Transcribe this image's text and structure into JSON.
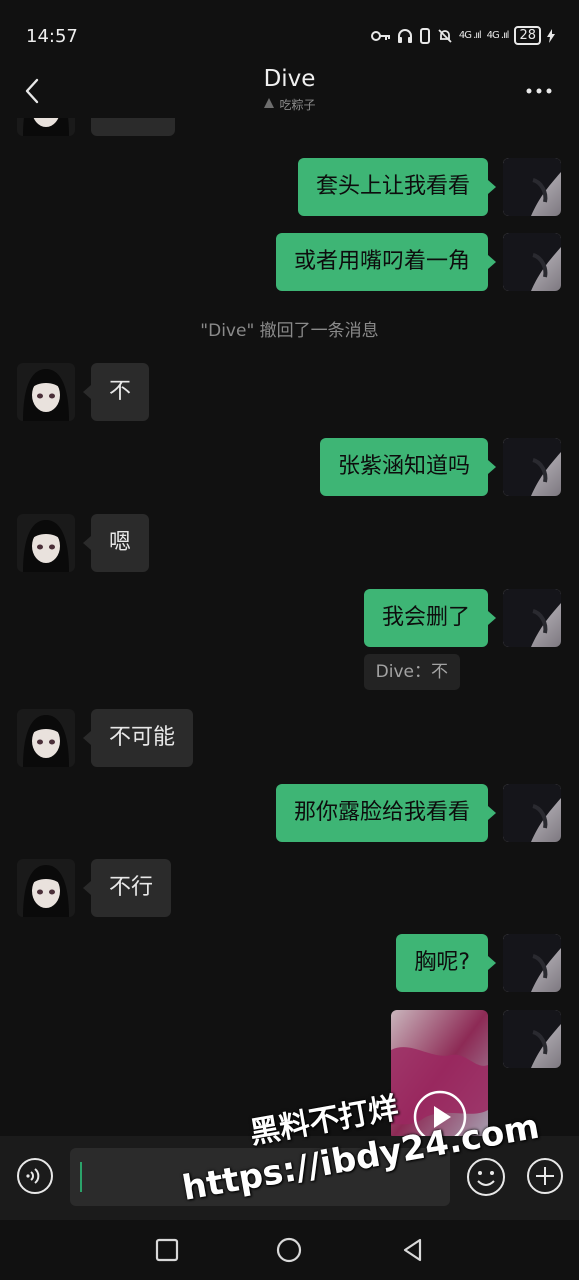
{
  "status_bar": {
    "time": "14:57",
    "signal1": "4G .ııl",
    "signal2": "4G .ııl",
    "battery": "28"
  },
  "header": {
    "title": "Dive",
    "subtitle": "吃粽子"
  },
  "messages": {
    "m0": "",
    "m1": "套头上让我看看",
    "m2": "或者用嘴叼着一角",
    "recall_note": "\"Dive\" 撤回了一条消息",
    "m3": "不",
    "m4": "张紫涵知道吗",
    "m5": "嗯",
    "m6": "我会删了",
    "quote": "Dive：不",
    "m7": "不可能",
    "m8": "那你露脸给我看看",
    "m9": "不行",
    "m10": "胸呢?"
  },
  "watermark": {
    "line1": "黑料不打烊",
    "line2": "https://ibdy24.com"
  },
  "colors": {
    "outgoing_bubble": "#3eb575",
    "incoming_bubble": "#2b2b2b",
    "background": "#111111"
  }
}
